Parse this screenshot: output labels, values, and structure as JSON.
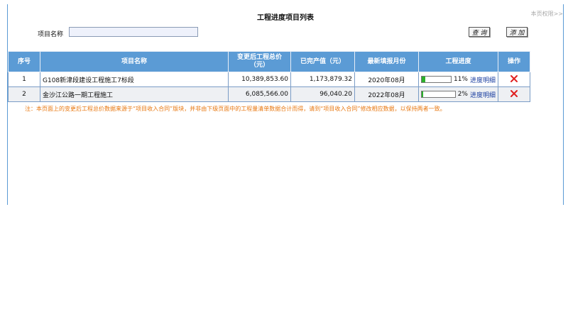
{
  "header": {
    "title": "工程进度项目列表",
    "permission_link": "本页权限>>"
  },
  "search": {
    "label": "项目名称",
    "value": "",
    "placeholder": "",
    "query_label": "查 询",
    "add_label": "添 加"
  },
  "table": {
    "columns": [
      "序号",
      "项目名称",
      "变更后工程总价（元）",
      "已完产值（元）",
      "最新填报月份",
      "工程进度",
      "操作"
    ],
    "rows": [
      {
        "index": "1",
        "name": "G108新津段建设工程施工7标段",
        "total_price": "10,389,853.60",
        "completed_value": "1,173,879.32",
        "month": "2020年08月",
        "progress": 11,
        "progress_text": "11%",
        "detail_label": "进度明细",
        "action_icon": "delete-icon"
      },
      {
        "index": "2",
        "name": "金沙江公路一期工程施工",
        "total_price": "6,085,566.00",
        "completed_value": "96,040.20",
        "month": "2022年08月",
        "progress": 2,
        "progress_text": "2%",
        "detail_label": "进度明细",
        "action_icon": "delete-icon"
      }
    ]
  },
  "note": "注：本页面上的变更后工程总价数据来源于“项目收入合同”版块，并非由下级页面中的工程量清单数据合计而得，请到“项目收入合同”修改相应数据，以保持两者一致。",
  "colors": {
    "header_bg": "#5b9bd5",
    "progress_fill": "#2bb02b",
    "note_text": "#e8770f",
    "delete_icon": "#e02020",
    "link": "#1a3ea0"
  }
}
